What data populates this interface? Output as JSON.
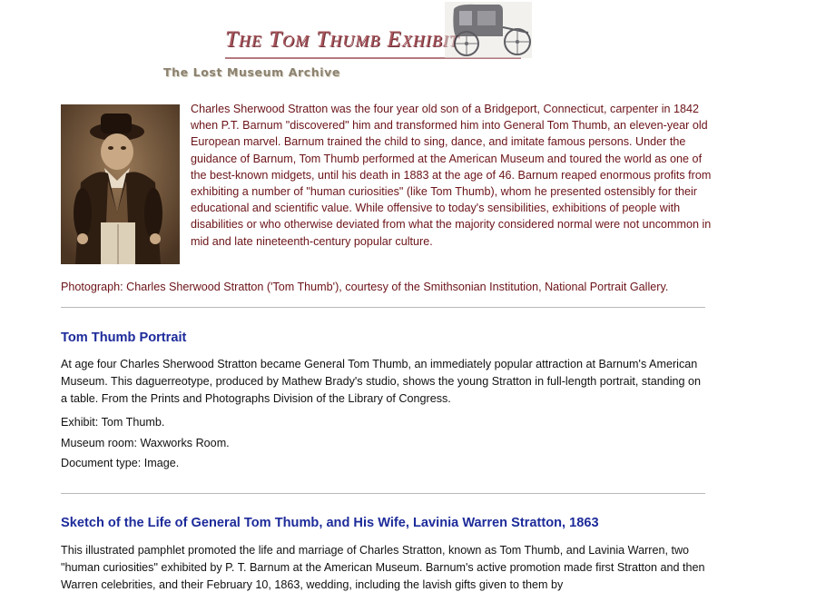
{
  "banner": {
    "title": "The Tom Thumb Exhibit",
    "subtitle": "The Lost Museum Archive"
  },
  "intro": {
    "text": "Charles Sherwood Stratton was the four year old son of a Bridgeport, Connecticut, carpenter in 1842 when P.T. Barnum \"discovered\" him and transformed him into General Tom Thumb, an eleven-year old European marvel. Barnum trained the child to sing, dance, and imitate famous persons. Under the guidance of Barnum, Tom Thumb performed at the American Museum and toured the world as one of the best-known midgets, until his death in 1883 at the age of 46. Barnum reaped enormous profits from exhibiting a number of \"human curiosities\" (like Tom Thumb), whom he presented ostensibly for their educational and scientific value. While offensive to today's sensibilities, exhibitions of people with disabilities or who otherwise deviated from what the majority considered normal were not uncommon in mid and late nineteenth-century popular culture.",
    "caption": "Photograph: Charles Sherwood Stratton ('Tom Thumb'), courtesy of the Smithsonian Institution, National Portrait Gallery."
  },
  "entries": [
    {
      "title": "Tom Thumb Portrait",
      "description": "At age four Charles Sherwood Stratton became General Tom Thumb, an immediately popular attraction at Barnum's American Museum. This daguerreotype, produced by Mathew Brady's studio, shows the young Stratton in full-length portrait, standing on a table. From the Prints and Photographs Division of the Library of Congress.",
      "exhibit": "Exhibit: Tom Thumb.",
      "room": "Museum room: Waxworks Room.",
      "doctype": "Document type: Image."
    },
    {
      "title": "Sketch of the Life of General Tom Thumb, and His Wife, Lavinia Warren Stratton, 1863",
      "description": "This illustrated pamphlet promoted the life and marriage of Charles Stratton, known as Tom Thumb, and Lavinia Warren, two \"human curiosities\" exhibited by P. T. Barnum at the American Museum. Barnum's active promotion made first Stratton and then Warren celebrities, and their February 10, 1863, wedding, including the lavish gifts given to them by"
    }
  ],
  "colors": {
    "intro_text": "#6b1318",
    "entry_title": "#1d2b9a",
    "banner_title": "#a8555c"
  },
  "icons": {
    "banner_image": "horse-carriage",
    "portrait_image": "tom-thumb-photograph"
  }
}
